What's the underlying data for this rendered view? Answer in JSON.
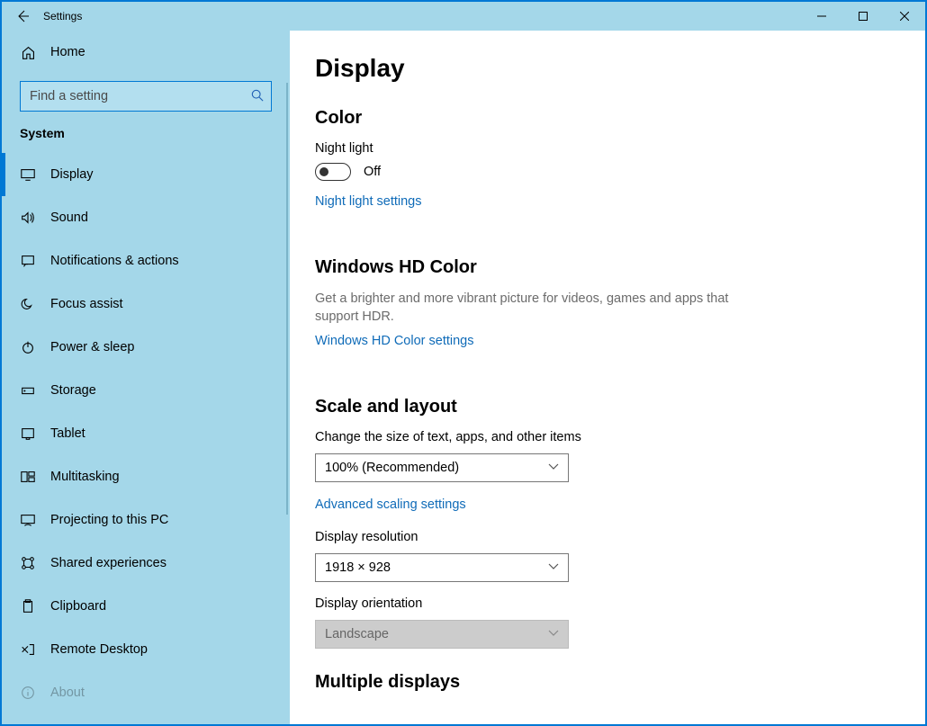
{
  "window": {
    "title": "Settings"
  },
  "sidebar": {
    "home": "Home",
    "search_placeholder": "Find a setting",
    "category": "System",
    "items": [
      {
        "label": "Display",
        "selected": true
      },
      {
        "label": "Sound"
      },
      {
        "label": "Notifications & actions"
      },
      {
        "label": "Focus assist"
      },
      {
        "label": "Power & sleep"
      },
      {
        "label": "Storage"
      },
      {
        "label": "Tablet"
      },
      {
        "label": "Multitasking"
      },
      {
        "label": "Projecting to this PC"
      },
      {
        "label": "Shared experiences"
      },
      {
        "label": "Clipboard"
      },
      {
        "label": "Remote Desktop"
      },
      {
        "label": "About"
      }
    ]
  },
  "main": {
    "title": "Display",
    "color": {
      "heading": "Color",
      "nightlight_label": "Night light",
      "nightlight_state": "Off",
      "nightlight_link": "Night light settings"
    },
    "hd": {
      "heading": "Windows HD Color",
      "desc": "Get a brighter and more vibrant picture for videos, games and apps that support HDR.",
      "link": "Windows HD Color settings"
    },
    "scale": {
      "heading": "Scale and layout",
      "size_label": "Change the size of text, apps, and other items",
      "size_value": "100% (Recommended)",
      "adv_link": "Advanced scaling settings",
      "res_label": "Display resolution",
      "res_value": "1918 × 928",
      "orient_label": "Display orientation",
      "orient_value": "Landscape"
    },
    "multi": {
      "heading": "Multiple displays"
    }
  }
}
